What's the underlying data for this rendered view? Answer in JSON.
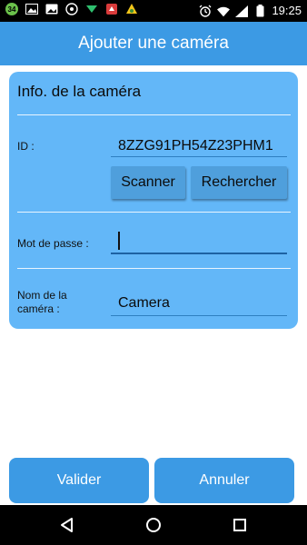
{
  "status_bar": {
    "notification_badge": "34",
    "time": "19:25"
  },
  "app_bar": {
    "title": "Ajouter une caméra"
  },
  "form": {
    "section_title": "Info. de la caméra",
    "id_label": "ID :",
    "id_value": "8ZZG91PH54Z23PHM1",
    "scan_button": "Scanner",
    "search_button": "Rechercher",
    "password_label": "Mot de passe :",
    "password_value": "",
    "camera_name_label_line1": "Nom de la",
    "camera_name_label_line2": "caméra :",
    "camera_name_value": "Camera"
  },
  "actions": {
    "validate": "Valider",
    "cancel": "Annuler"
  },
  "colors": {
    "accent": "#3c9ae4",
    "panel": "#63b7f8"
  }
}
